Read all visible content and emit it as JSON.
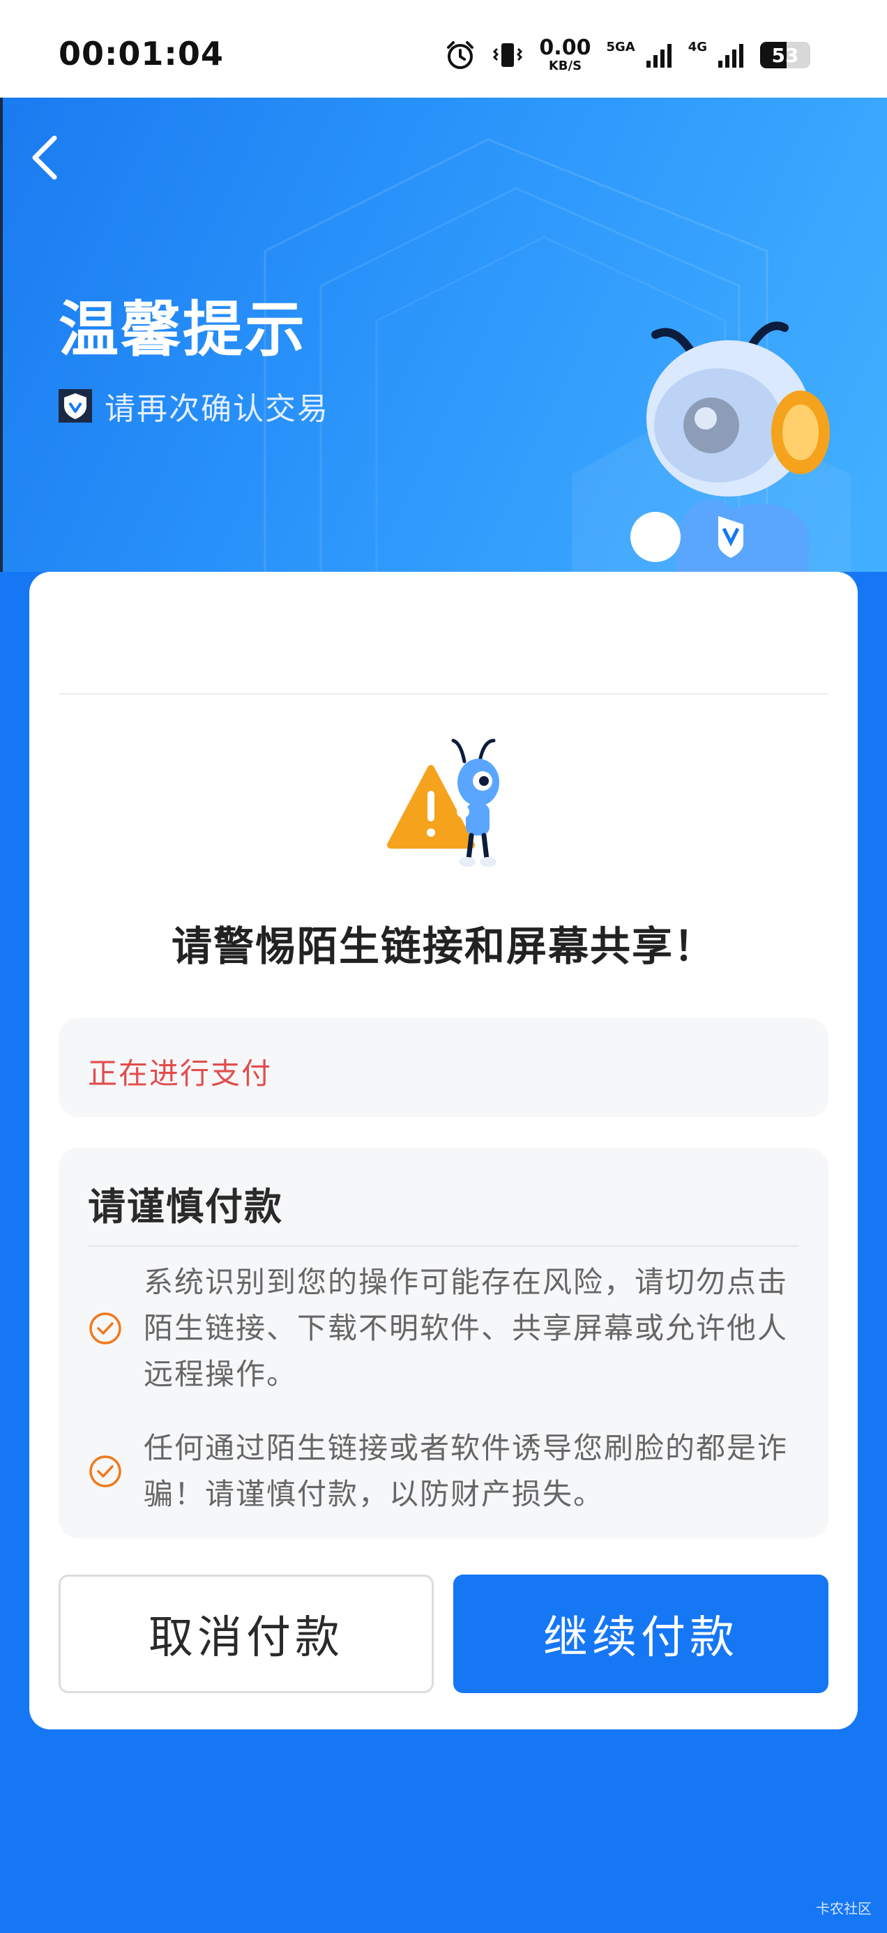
{
  "status_bar": {
    "time": "00:01:04",
    "net_speed_value": "0.00",
    "net_speed_unit": "KB/S",
    "sim1_label": "5GA",
    "sim2_label": "4G",
    "battery_level": "53",
    "icons": [
      "alarm-icon",
      "vibrate-icon",
      "signal-5ga-icon",
      "signal-4g-icon",
      "battery-icon"
    ]
  },
  "hero": {
    "title": "温馨提示",
    "subtitle": "请再次确认交易",
    "back_icon": "chevron-left-icon"
  },
  "dialog": {
    "warning_title": "请警惕陌生链接和屏幕共享！",
    "status_text": "正在进行支付",
    "notice": {
      "title": "请谨慎付款",
      "items": [
        "系统识别到您的操作可能存在风险，请切勿点击陌生链接、下载不明软件、共享屏幕或允许他人远程操作。",
        "任何通过陌生链接或者软件诱导您刷脸的都是诈骗！请谨慎付款，以防财产损失。"
      ]
    },
    "cancel_label": "取消付款",
    "continue_label": "继续付款"
  },
  "watermark": "卡农社区",
  "colors": {
    "primary": "#1677f5",
    "danger": "#e24c4c",
    "warning_orange": "#f5a21d",
    "check_orange": "#f07a1e"
  }
}
